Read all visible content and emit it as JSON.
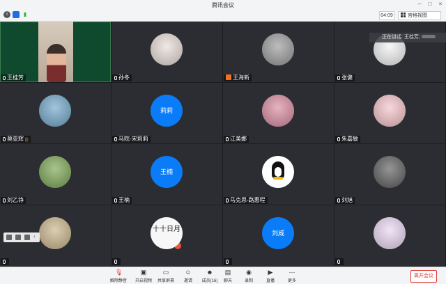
{
  "window": {
    "title": "腾讯会议"
  },
  "toolbar": {
    "timer": "04:09",
    "view_label": "宫格视图"
  },
  "speaking": {
    "label": "正在讲话: 王桂芳;"
  },
  "participants": [
    {
      "name": "王桂芳",
      "avatar": "video",
      "color": "#caa",
      "signal": ""
    },
    {
      "name": "孙冬",
      "avatar": "photo-girl",
      "color": "#e8dcd6",
      "signal": ""
    },
    {
      "name": "王海新",
      "avatar": "photo-cat",
      "color": "#9a9a9a",
      "signal": ""
    },
    {
      "name": "张健",
      "avatar": "photo-sketch",
      "color": "#f2f2f2",
      "signal": ""
    },
    {
      "name": "莫亚辉",
      "avatar": "photo-landscape",
      "color": "#6fa7c9",
      "signal": "|||"
    },
    {
      "name": "马院-宋莉莉",
      "avatar": "text",
      "avatar_text": "莉莉",
      "color": "#0a7cf7",
      "signal": ""
    },
    {
      "name": "江美娜",
      "avatar": "photo-field",
      "color": "#d98aa0",
      "signal": ""
    },
    {
      "name": "朱嘉敏",
      "avatar": "photo-cartoon",
      "color": "#f4c2c8",
      "signal": ""
    },
    {
      "name": "刘乙铮",
      "avatar": "photo-path",
      "color": "#7aa552",
      "signal": ""
    },
    {
      "name": "王楠",
      "avatar": "text",
      "avatar_text": "王楠",
      "color": "#0a7cf7",
      "signal": ""
    },
    {
      "name": "马克思-路惠程",
      "avatar": "photo-penguin",
      "color": "#ffffff",
      "signal": ""
    },
    {
      "name": "刘旭",
      "avatar": "photo-man",
      "color": "#5c5c5c",
      "signal": ""
    },
    {
      "name": "",
      "avatar": "photo-giraffe",
      "color": "#c9b48a",
      "signal": ""
    },
    {
      "name": "",
      "avatar": "photo-calligraphy",
      "color": "#f7f7f7",
      "avatar_text": "十十日月",
      "signal": ""
    },
    {
      "name": "",
      "avatar": "text",
      "avatar_text": "刘威",
      "color": "#0a7cf7",
      "signal": ""
    },
    {
      "name": "",
      "avatar": "photo-anime",
      "color": "#e9d7f2",
      "signal": ""
    }
  ],
  "bottombar": {
    "buttons": [
      {
        "label": "解除静音",
        "icon": "mic-muted-icon"
      },
      {
        "label": "开启视频",
        "icon": "camera-off-icon"
      },
      {
        "label": "共享屏幕",
        "icon": "screen-share-icon"
      },
      {
        "label": "邀请",
        "icon": "invite-icon"
      },
      {
        "label": "成员(16)",
        "icon": "members-icon"
      },
      {
        "label": "聊天",
        "icon": "chat-icon"
      },
      {
        "label": "录制",
        "icon": "record-icon"
      },
      {
        "label": "直播",
        "icon": "live-icon"
      },
      {
        "label": "更多",
        "icon": "more-icon"
      }
    ],
    "end_label": "离开会议"
  }
}
